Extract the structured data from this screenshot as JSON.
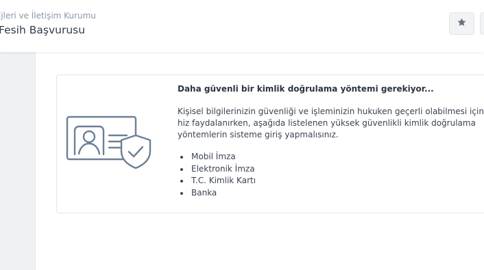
{
  "header": {
    "subtitle": "ijleri ve İletişim Kurumu",
    "title": "Fesih Başvurusu",
    "favorite_icon": "star-icon"
  },
  "notice": {
    "icon": "id-card-shield-icon",
    "heading": "Daha güvenli bir kimlik doğrulama yöntemi gerekiyor...",
    "body": "Kişisel bilgilerinizin güvenliği ve işleminizin hukuken geçerli olabilmesi için bu hiz faydalanırken, aşağıda listelenen yüksek güvenlikli kimlik doğrulama yöntemlerin sisteme giriş yapmalısınız.",
    "methods": [
      "Mobil İmza",
      "Elektronik İmza",
      "T.C. Kimlik Kartı",
      "Banka"
    ]
  },
  "colors": {
    "icon_stroke": "#6b7f95",
    "sidebar_bg": "#f0f1f3",
    "border": "#e2e5e9"
  }
}
